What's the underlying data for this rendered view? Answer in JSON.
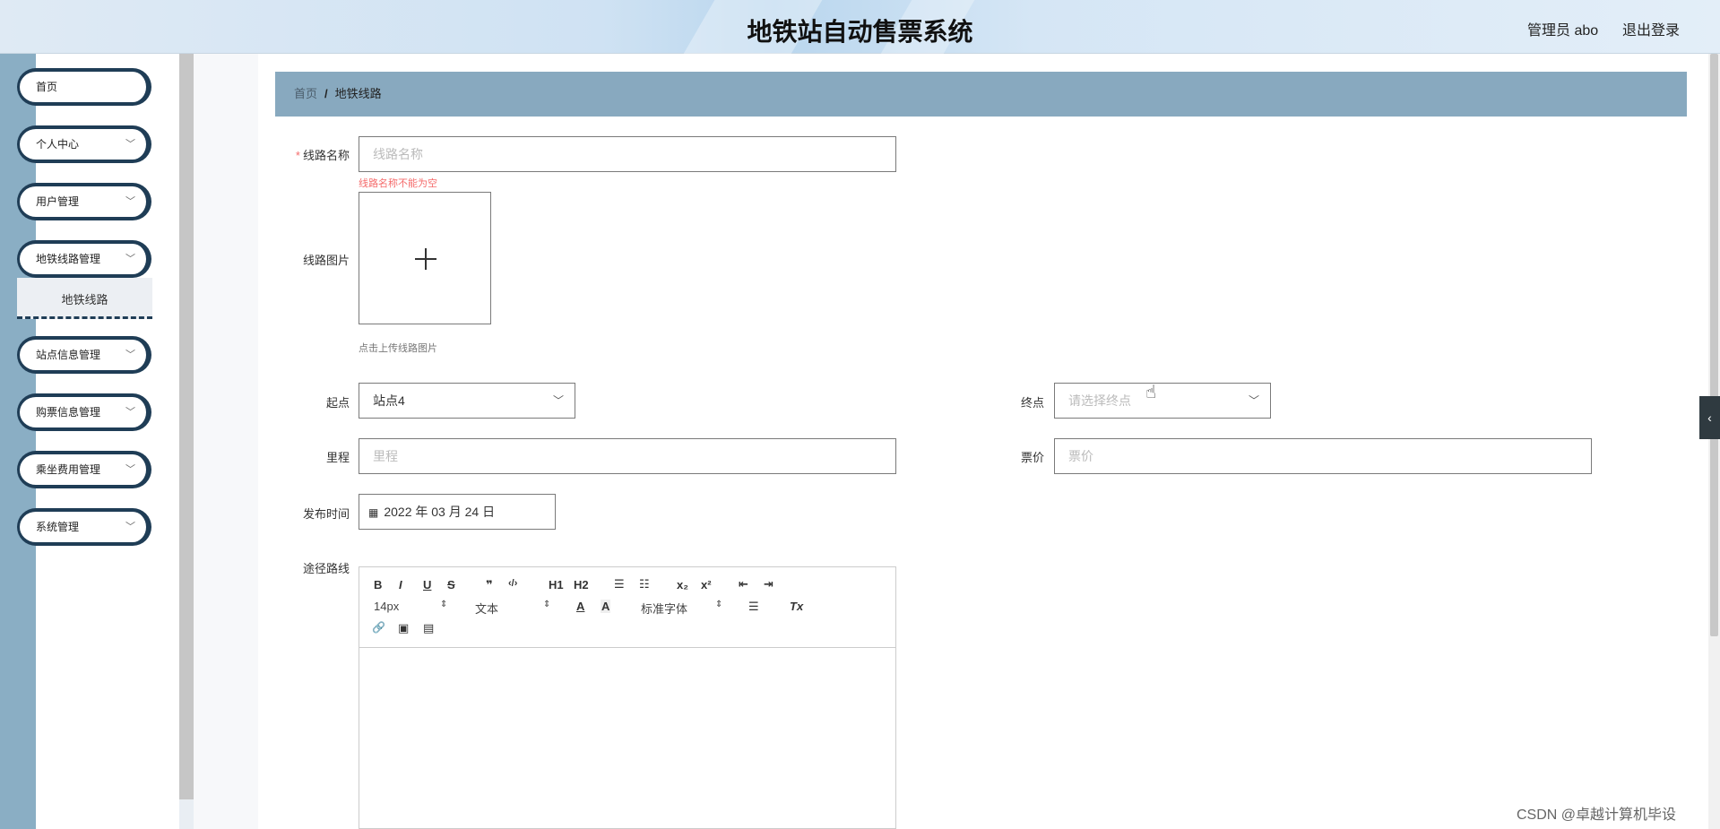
{
  "header": {
    "title": "地铁站自动售票系统",
    "user": "管理员 abo",
    "logout": "退出登录"
  },
  "sidebar": {
    "items": [
      {
        "label": "首页"
      },
      {
        "label": "个人中心",
        "chevron": "﹀"
      },
      {
        "label": "用户管理",
        "chevron": "﹀"
      },
      {
        "label": "地铁线路管理",
        "chevron": "﹀"
      },
      {
        "label": "站点信息管理",
        "chevron": "﹀"
      },
      {
        "label": "购票信息管理",
        "chevron": "﹀"
      },
      {
        "label": "乘坐费用管理",
        "chevron": "﹀"
      },
      {
        "label": "系统管理",
        "chevron": "﹀"
      }
    ],
    "submenu": {
      "label": "地铁线路"
    }
  },
  "breadcrumb": {
    "home": "首页",
    "separator": "/",
    "current": "地铁线路"
  },
  "form": {
    "required_mark": "*",
    "line_name": {
      "label": "线路名称",
      "placeholder": "线路名称",
      "error": "线路名称不能为空"
    },
    "line_image": {
      "label": "线路图片",
      "hint": "点击上传线路图片"
    },
    "start": {
      "label": "起点",
      "value": "站点4"
    },
    "end": {
      "label": "终点",
      "placeholder": "请选择终点"
    },
    "mileage": {
      "label": "里程",
      "placeholder": "里程"
    },
    "price": {
      "label": "票价",
      "placeholder": "票价"
    },
    "publish_time": {
      "label": "发布时间",
      "value": "2022 年 03 月 24 日"
    },
    "route": {
      "label": "途径路线"
    }
  },
  "editor": {
    "bold": "B",
    "italic": "I",
    "underline": "U",
    "strike": "S",
    "quote": "❞",
    "code": "‹/›",
    "h1": "H1",
    "h2": "H2",
    "ordered_list": "☰",
    "bullet_list": "☷",
    "sub": "x₂",
    "sup": "x²",
    "outdent": "⇤",
    "indent": "⇥",
    "font_size": "14px",
    "text_style": "文本",
    "font_family": "标准字体",
    "font_color": "A",
    "bg_color": "A",
    "align": "☰",
    "clear": "Tx",
    "link": "🔗",
    "image": "▣",
    "video": "▤",
    "select_arrow": "⇕"
  },
  "collapse_tab": "‹",
  "watermark": "CSDN @卓越计算机毕设"
}
